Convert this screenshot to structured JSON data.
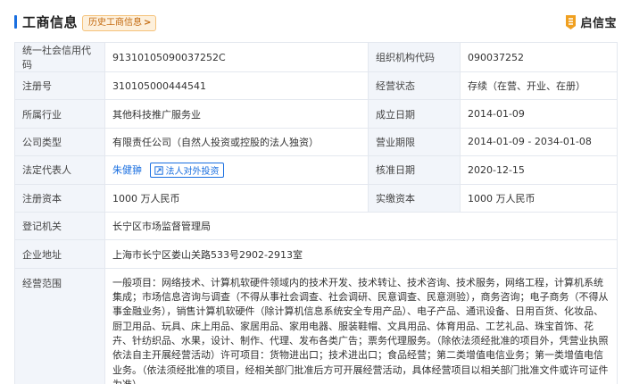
{
  "header": {
    "title": "工商信息",
    "history_label": "历史工商信息",
    "brand_name": "启信宝",
    "accent_color": "#1a6fe0"
  },
  "rows": {
    "credit_code": {
      "label": "统一社会信用代码",
      "value": "91310105090037252C"
    },
    "org_code": {
      "label": "组织机构代码",
      "value": "090037252"
    },
    "reg_no": {
      "label": "注册号",
      "value": "310105000444541"
    },
    "status": {
      "label": "经营状态",
      "value": "存续（在营、开业、在册）"
    },
    "industry": {
      "label": "所属行业",
      "value": "其他科技推广服务业"
    },
    "founded": {
      "label": "成立日期",
      "value": "2014-01-09"
    },
    "company_type": {
      "label": "公司类型",
      "value": "有限责任公司（自然人投资或控股的法人独资）"
    },
    "term": {
      "label": "营业期限",
      "value": "2014-01-09 - 2034-01-08"
    },
    "legal_rep": {
      "label": "法定代表人",
      "value": "朱健翀",
      "invest_label": "法人对外投资"
    },
    "approval_date": {
      "label": "核准日期",
      "value": "2020-12-15"
    },
    "reg_capital": {
      "label": "注册资本",
      "value": "1000 万人民币"
    },
    "paid_capital": {
      "label": "实缴资本",
      "value": "1000 万人民币"
    },
    "authority": {
      "label": "登记机关",
      "value": "长宁区市场监督管理局"
    },
    "address": {
      "label": "企业地址",
      "value": "上海市长宁区娄山关路533号2902-2913室"
    },
    "scope": {
      "label": "经营范围",
      "value": "一般项目：网络技术、计算机软硬件领域内的技术开发、技术转让、技术咨询、技术服务，网络工程，计算机系统集成；市场信息咨询与调查（不得从事社会调查、社会调研、民意调查、民意测验），商务咨询；电子商务（不得从事金融业务），销售计算机软硬件（除计算机信息系统安全专用产品）、电子产品、通讯设备、日用百货、化妆品、厨卫用品、玩具、床上用品、家居用品、家用电器、服装鞋帽、文具用品、体育用品、工艺礼品、珠宝首饰、花卉、针纺织品、水果，设计、制作、代理、发布各类广告；票务代理服务。（除依法须经批准的项目外，凭营业执照依法自主开展经营活动）许可项目：货物进出口；技术进出口；食品经营；第二类增值电信业务；第一类增值电信业务。（依法须经批准的项目，经相关部门批准后方可开展经营活动，具体经营项目以相关部门批准文件或许可证件为准）"
    }
  }
}
